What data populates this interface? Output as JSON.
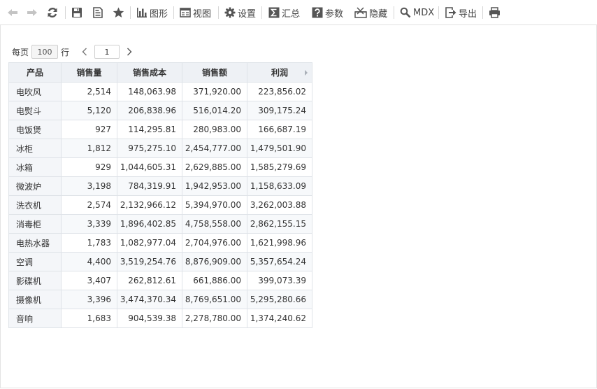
{
  "toolbar": {
    "chart_label": "图形",
    "view_label": "视图",
    "settings_label": "设置",
    "summary_label": "汇总",
    "params_label": "参数",
    "hide_label": "隐藏",
    "mdx_label": "MDX",
    "export_label": "导出"
  },
  "pager": {
    "prefix": "每页",
    "rows_per_page": "100",
    "suffix": "行",
    "current_page": "1"
  },
  "table": {
    "headers": [
      "产品",
      "销售量",
      "销售成本",
      "销售额",
      "利润"
    ],
    "rows": [
      [
        "电吹风",
        "2,514",
        "148,063.98",
        "371,920.00",
        "223,856.02"
      ],
      [
        "电熨斗",
        "5,120",
        "206,838.96",
        "516,014.20",
        "309,175.24"
      ],
      [
        "电饭煲",
        "927",
        "114,295.81",
        "280,983.00",
        "166,687.19"
      ],
      [
        "冰柜",
        "1,812",
        "975,275.10",
        "2,454,777.00",
        "1,479,501.90"
      ],
      [
        "冰箱",
        "929",
        "1,044,605.31",
        "2,629,885.00",
        "1,585,279.69"
      ],
      [
        "微波炉",
        "3,198",
        "784,319.91",
        "1,942,953.00",
        "1,158,633.09"
      ],
      [
        "洗衣机",
        "2,574",
        "2,132,966.12",
        "5,394,970.00",
        "3,262,003.88"
      ],
      [
        "消毒柜",
        "3,339",
        "1,896,402.85",
        "4,758,558.00",
        "2,862,155.15"
      ],
      [
        "电热水器",
        "1,783",
        "1,082,977.04",
        "2,704,976.00",
        "1,621,998.96"
      ],
      [
        "空调",
        "4,400",
        "3,519,254.76",
        "8,876,909.00",
        "5,357,654.24"
      ],
      [
        "影碟机",
        "3,407",
        "262,812.61",
        "661,886.00",
        "399,073.39"
      ],
      [
        "摄像机",
        "3,396",
        "3,474,370.34",
        "8,769,651.00",
        "5,295,280.66"
      ],
      [
        "音响",
        "1,683",
        "904,539.38",
        "2,278,780.00",
        "1,374,240.62"
      ]
    ]
  }
}
